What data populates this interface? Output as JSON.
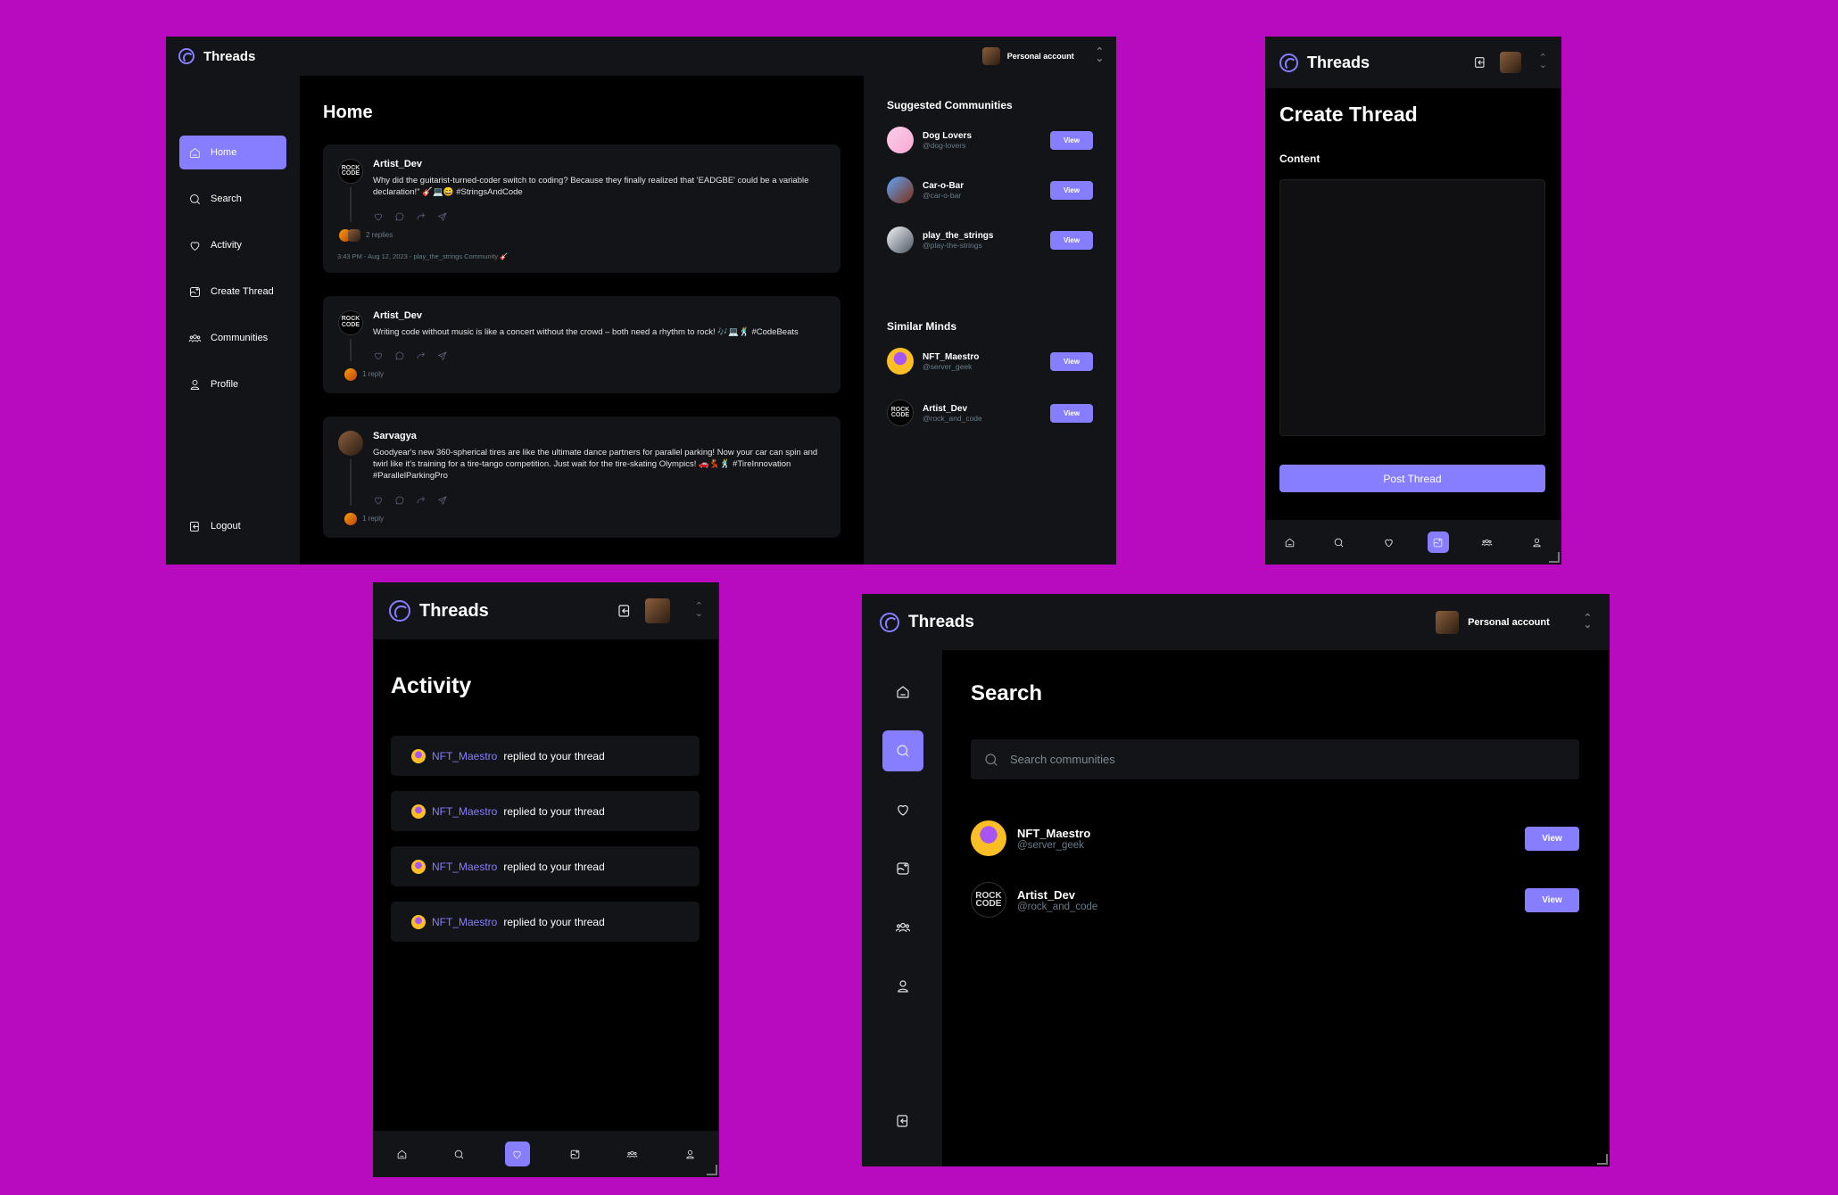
{
  "app": {
    "name": "Threads"
  },
  "colors": {
    "accent": "#877eff",
    "background": "#b80bbf",
    "panel": "#121417",
    "muted": "#697c89"
  },
  "account": {
    "label": "Personal account"
  },
  "sidebar": {
    "items": [
      {
        "label": "Home",
        "icon": "home-icon"
      },
      {
        "label": "Search",
        "icon": "search-icon"
      },
      {
        "label": "Activity",
        "icon": "heart-icon"
      },
      {
        "label": "Create Thread",
        "icon": "create-thread-icon"
      },
      {
        "label": "Communities",
        "icon": "communities-icon"
      },
      {
        "label": "Profile",
        "icon": "profile-icon"
      }
    ],
    "logout": "Logout"
  },
  "home": {
    "title": "Home",
    "threads": [
      {
        "author": "Artist_Dev",
        "avatar": "ROCK CODE",
        "text": "Why did the guitarist-turned-coder switch to coding? Because they finally realized that 'EADGBE' could be a variable declaration!\" 🎸💻😄 #StringsAndCode",
        "replies": "2 replies",
        "meta": "3:43 PM - Aug 12, 2023 - play_the_strings Community 🎸"
      },
      {
        "author": "Artist_Dev",
        "avatar": "ROCK CODE",
        "text": "Writing code without music is like a concert without the crowd – both need a rhythm to rock! 🎶💻🕺 #CodeBeats",
        "replies": "1 reply",
        "meta": ""
      },
      {
        "author": "Sarvagya",
        "avatar": "",
        "text": "Goodyear's new 360-spherical tires are like the ultimate dance partners for parallel parking! Now your car can spin and twirl like it's training for a tire-tango competition. Just wait for the tire-skating Olympics! 🚗💃🕺 #TireInnovation #ParallelParkingPro",
        "replies": "1 reply",
        "meta": ""
      }
    ]
  },
  "suggested": {
    "communities_title": "Suggested Communities",
    "communities": [
      {
        "name": "Dog Lovers",
        "handle": "@dog-lovers",
        "button": "View"
      },
      {
        "name": "Car-o-Bar",
        "handle": "@car-o-bar",
        "button": "View"
      },
      {
        "name": "play_the_strings",
        "handle": "@play-the-strings",
        "button": "View"
      }
    ],
    "minds_title": "Similar Minds",
    "minds": [
      {
        "name": "NFT_Maestro",
        "handle": "@server_geek",
        "button": "View"
      },
      {
        "name": "Artist_Dev",
        "handle": "@rock_and_code",
        "button": "View",
        "avatar": "ROCK CODE"
      }
    ]
  },
  "create": {
    "title": "Create Thread",
    "content_label": "Content",
    "content_value": "",
    "post_button": "Post Thread"
  },
  "activity": {
    "title": "Activity",
    "items": [
      {
        "user": "NFT_Maestro",
        "text": "replied to your thread"
      },
      {
        "user": "NFT_Maestro",
        "text": "replied to your thread"
      },
      {
        "user": "NFT_Maestro",
        "text": "replied to your thread"
      },
      {
        "user": "NFT_Maestro",
        "text": "replied to your thread"
      }
    ]
  },
  "search": {
    "title": "Search",
    "placeholder": "Search communities",
    "results": [
      {
        "name": "NFT_Maestro",
        "handle": "@server_geek",
        "button": "View"
      },
      {
        "name": "Artist_Dev",
        "handle": "@rock_and_code",
        "button": "View",
        "avatar": "ROCK CODE"
      }
    ]
  }
}
